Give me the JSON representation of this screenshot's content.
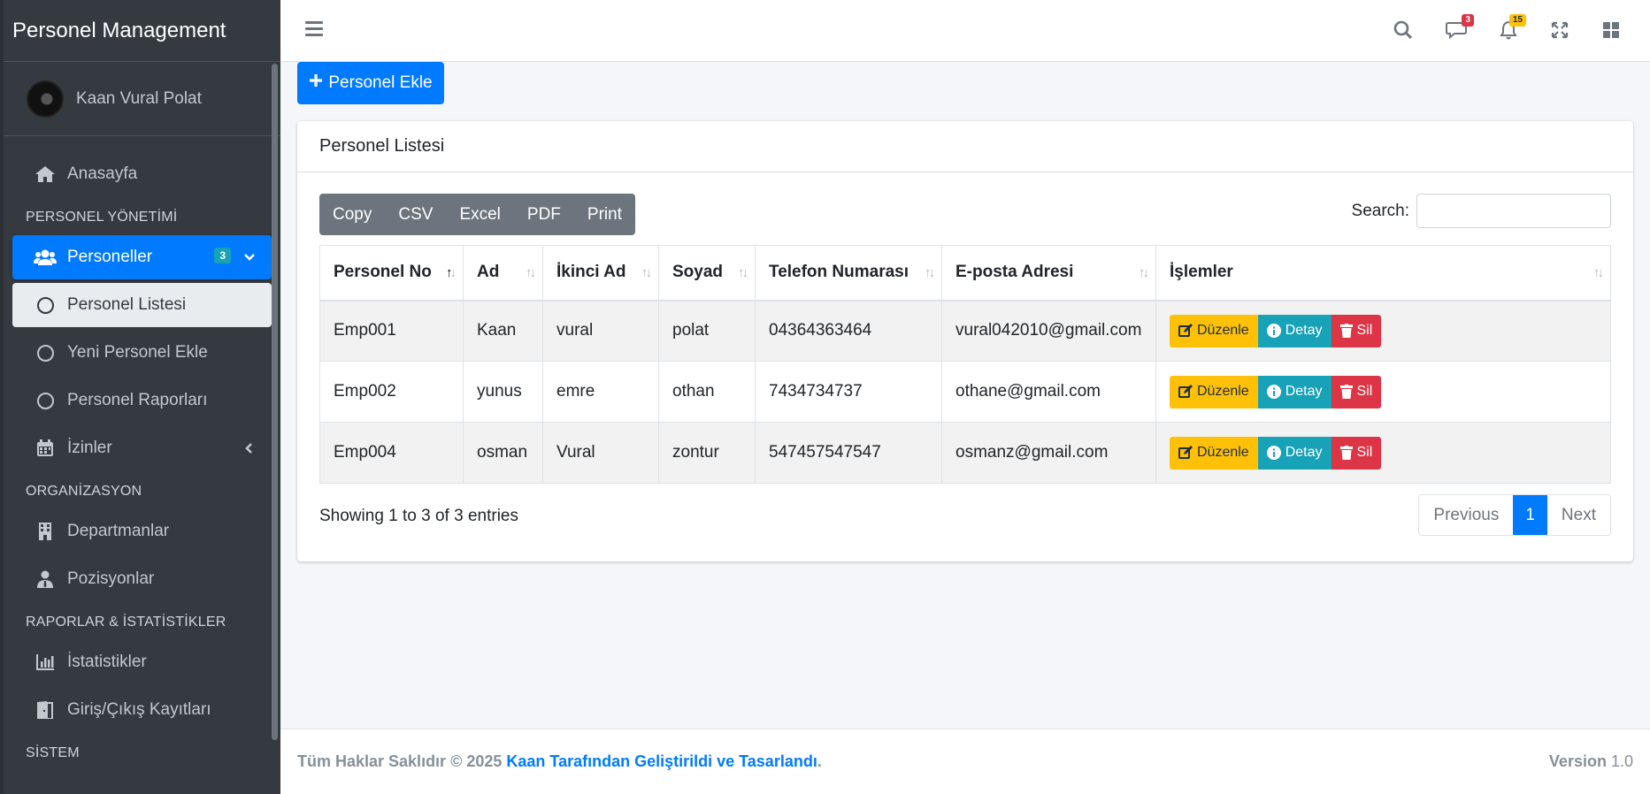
{
  "app": {
    "brand": "Personel Management"
  },
  "user": {
    "name": "Kaan Vural Polat"
  },
  "sidebar": {
    "home": "Anasayfa",
    "section_personel": "PERSONEL YÖNETİMİ",
    "personeller": "Personeller",
    "personeller_badge": "3",
    "personel_listesi": "Personel Listesi",
    "yeni_personel": "Yeni Personel Ekle",
    "raporlar": "Personel Raporları",
    "izinler": "İzinler",
    "section_org": "ORGANİZASYON",
    "departmanlar": "Departmanlar",
    "pozisyonlar": "Pozisyonlar",
    "section_reports": "RAPORLAR & İSTATİSTİKLER",
    "istatistikler": "İstatistikler",
    "giris_cikis": "Giriş/Çıkış Kayıtları",
    "section_system": "SİSTEM"
  },
  "topbar": {
    "messages_count": "3",
    "notifications_count": "15"
  },
  "content": {
    "add_button": "Personel Ekle",
    "card_title": "Personel Listesi",
    "export_buttons": [
      "Copy",
      "CSV",
      "Excel",
      "PDF",
      "Print"
    ],
    "search_label": "Search:",
    "columns": [
      "Personel No",
      "Ad",
      "İkinci Ad",
      "Soyad",
      "Telefon Numarası",
      "E-posta Adresi",
      "İşlemler"
    ],
    "rows": [
      [
        "Emp001",
        "Kaan",
        "vural",
        "polat",
        "04364363464",
        "vural042010@gmail.com"
      ],
      [
        "Emp002",
        "yunus",
        "emre",
        "othan",
        "7434734737",
        "othane@gmail.com"
      ],
      [
        "Emp004",
        "osman",
        "Vural",
        "zontur",
        "547457547547",
        "osmanz@gmail.com"
      ]
    ],
    "actions": {
      "edit": "Düzenle",
      "detail": "Detay",
      "delete": "Sil"
    },
    "info": "Showing 1 to 3 of 3 entries",
    "pager": {
      "previous": "Previous",
      "current": "1",
      "next": "Next"
    }
  },
  "footer": {
    "rights": "Tüm Haklar Saklıdır © 2025",
    "credit": "Kaan Tarafından Geliştirildi ve Tasarlandı",
    "period": ".",
    "version_label": "Version",
    "version": "1.0"
  }
}
